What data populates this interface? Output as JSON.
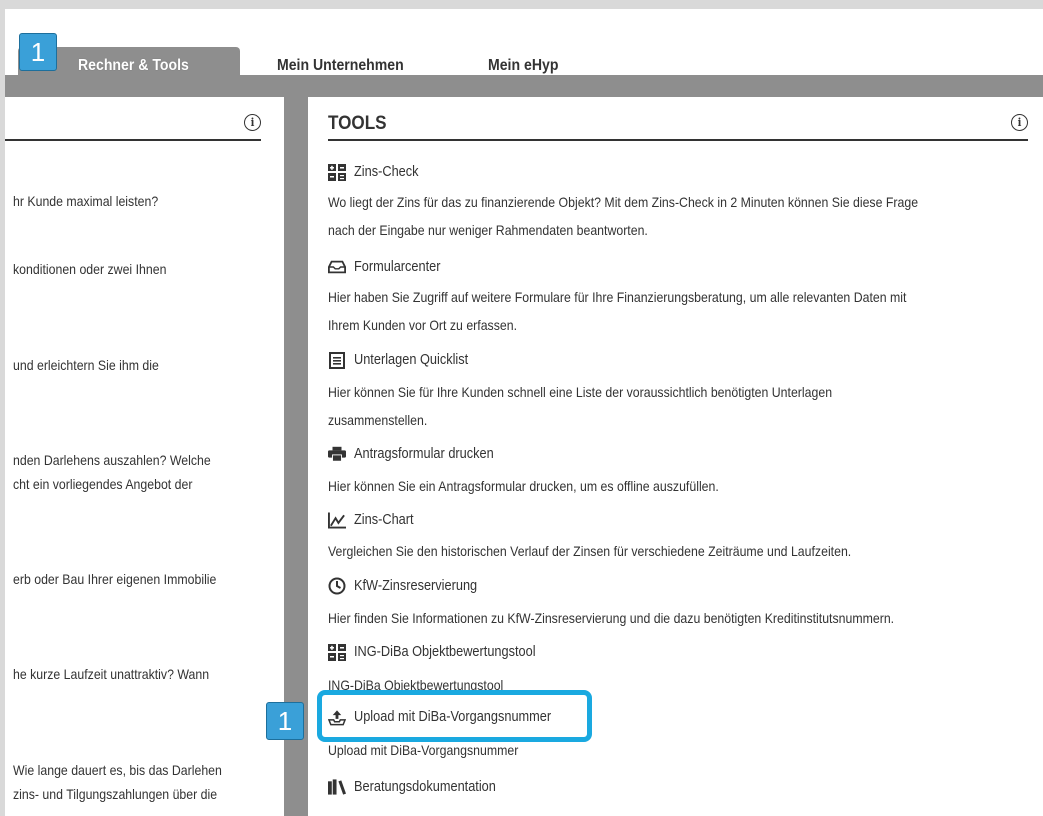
{
  "tabs": [
    {
      "label": "Rechner & Tools",
      "active": true
    },
    {
      "label": "Mein Unternehmen",
      "active": false
    },
    {
      "label": "Mein eHyp",
      "active": false
    }
  ],
  "callouts": {
    "badge_top": "1",
    "badge_bottom": "1"
  },
  "left_panel": {
    "lines": [
      "hr Kunde maximal leisten?",
      "konditionen oder zwei Ihnen",
      " und erleichtern Sie ihm die",
      "nden Darlehens auszahlen? Welche",
      "cht ein vorliegendes Angebot der",
      "erb oder Bau Ihrer eigenen Immobilie",
      "he kurze Laufzeit unattraktiv? Wann",
      "Wie lange dauert es, bis das Darlehen",
      "zins- und Tilgungszahlungen über die"
    ]
  },
  "right_panel": {
    "title": "TOOLS",
    "tools": [
      {
        "name": "Zins-Check",
        "icon": "calculator-icon",
        "desc": [
          "Wo liegt der Zins für das zu finanzierende Objekt? Mit dem Zins-Check in 2 Minuten können Sie diese Frage",
          "nach der Eingabe nur weniger Rahmendaten beantworten."
        ]
      },
      {
        "name": "Formularcenter",
        "icon": "inbox-icon",
        "desc": [
          "Hier haben Sie Zugriff auf weitere Formulare für Ihre Finanzierungsberatung, um alle relevanten Daten mit",
          "Ihrem Kunden vor Ort zu erfassen."
        ]
      },
      {
        "name": "Unterlagen Quicklist",
        "icon": "list-icon",
        "desc": [
          "Hier können Sie für Ihre Kunden schnell eine Liste der voraussichtlich benötigten Unterlagen",
          "zusammenstellen."
        ]
      },
      {
        "name": "Antragsformular drucken",
        "icon": "printer-icon",
        "desc": [
          "Hier können Sie ein Antragsformular drucken, um es offline auszufüllen."
        ]
      },
      {
        "name": "Zins-Chart",
        "icon": "line-chart-icon",
        "desc": [
          "Vergleichen Sie den historischen Verlauf der Zinsen für verschiedene Zeiträume und Laufzeiten."
        ]
      },
      {
        "name": "KfW-Zinsreservierung",
        "icon": "clock-icon",
        "desc": [
          "Hier finden Sie Informationen zu KfW-Zinsreservierung und die dazu benötigten Kreditinstitutsnummern."
        ]
      },
      {
        "name": "ING-DiBa Objektbewertungstool",
        "icon": "calculator-icon",
        "desc": [
          "ING-DiBa Objektbewertungstool"
        ]
      },
      {
        "name": "Upload mit DiBa-Vorgangsnummer",
        "icon": "upload-icon",
        "desc": [
          "Upload mit DiBa-Vorgangsnummer"
        ]
      },
      {
        "name": "Beratungsdokumentation",
        "icon": "books-icon",
        "desc": []
      }
    ]
  }
}
